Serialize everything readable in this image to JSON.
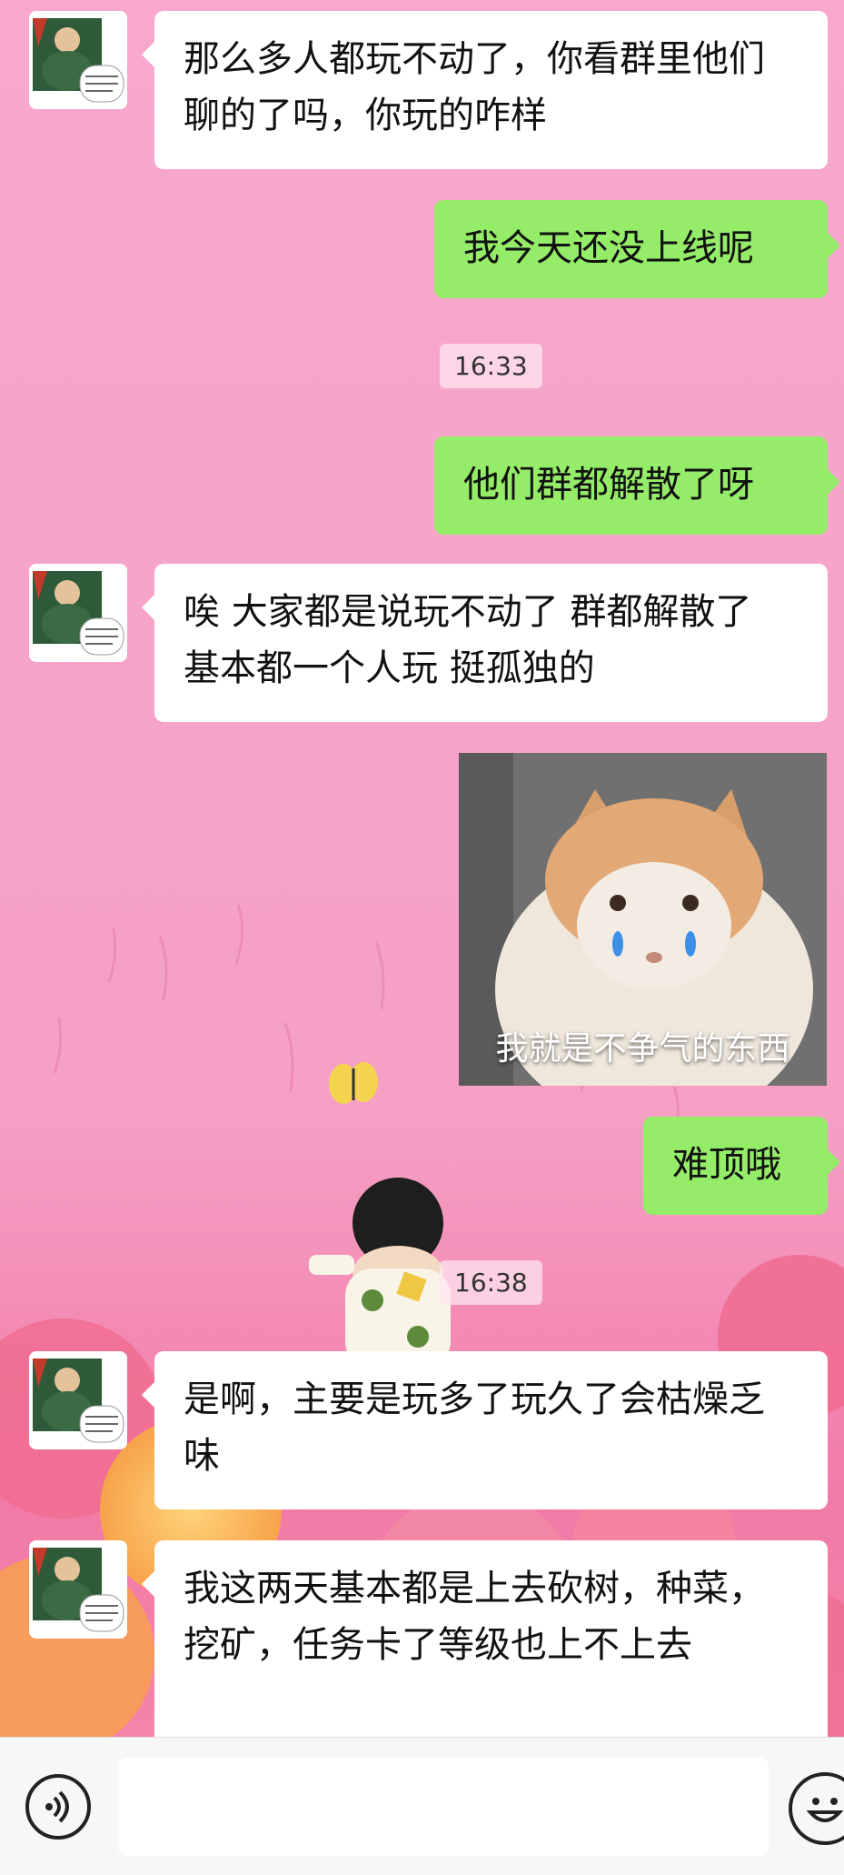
{
  "messages": [
    {
      "side": "left",
      "text": "那么多人都玩不动了，你看群里他们聊的了吗，你玩的咋样"
    },
    {
      "side": "right",
      "text": "我今天还没上线呢"
    },
    {
      "time": "16:33"
    },
    {
      "side": "right",
      "text": "他们群都解散了呀"
    },
    {
      "side": "left",
      "text": "唉 大家都是说玩不动了 群都解散了 基本都一个人玩 挺孤独的"
    },
    {
      "side": "right",
      "type": "sticker",
      "caption": "我就是不争气的东西"
    },
    {
      "side": "right",
      "text": "难顶哦"
    },
    {
      "time": "16:38"
    },
    {
      "side": "left",
      "text": "是啊，主要是玩多了玩久了会枯燥乏味"
    },
    {
      "side": "left",
      "text": "我这两天基本都是上去砍树，种菜，挖矿，任务卡了等级也上不上去"
    }
  ],
  "input": {
    "placeholder": ""
  },
  "icons": {
    "voice": "voice-icon",
    "emoji": "emoji-icon"
  },
  "colors": {
    "outgoing_bubble": "#95ec69",
    "incoming_bubble": "#ffffff"
  }
}
